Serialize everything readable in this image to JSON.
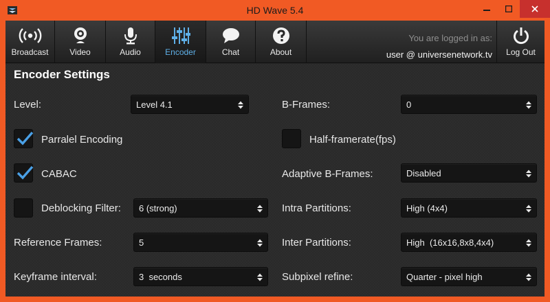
{
  "window": {
    "title": "HD Wave 5.4",
    "accent_color": "#f15a24",
    "close_color": "#c7302d"
  },
  "toolbar": {
    "tabs": [
      {
        "label": "Broadcast",
        "icon": "broadcast-icon"
      },
      {
        "label": "Video",
        "icon": "webcam-icon"
      },
      {
        "label": "Audio",
        "icon": "microphone-icon"
      },
      {
        "label": "Encoder",
        "icon": "sliders-icon",
        "active": true
      },
      {
        "label": "Chat",
        "icon": "chat-bubble-icon"
      },
      {
        "label": "About",
        "icon": "question-icon"
      }
    ],
    "active_color": "#5fb0e8",
    "login_line1": "You are logged in as:",
    "login_user": "user @ universenetwork.tv",
    "logout_label": "Log Out"
  },
  "encoder": {
    "heading": "Encoder Settings",
    "level": {
      "label": "Level:",
      "value": "Level 4.1"
    },
    "parallel": {
      "label": "Parralel Encoding",
      "checked": true
    },
    "cabac": {
      "label": "CABAC",
      "checked": true
    },
    "deblocking": {
      "label": "Deblocking Filter:",
      "checked": false,
      "value": "6 (strong)"
    },
    "ref_frames": {
      "label": "Reference Frames:",
      "value": "5"
    },
    "keyframe": {
      "label": "Keyframe interval:",
      "value": "3  seconds"
    },
    "bframes": {
      "label": "B-Frames:",
      "value": "0"
    },
    "half_framerate": {
      "label": "Half-framerate(fps)",
      "checked": false
    },
    "adaptive_bframes": {
      "label": "Adaptive B-Frames:",
      "value": "Disabled"
    },
    "intra": {
      "label": "Intra Partitions:",
      "value": "High (4x4)"
    },
    "inter": {
      "label": "Inter Partitions:",
      "value": "High  (16x16,8x8,4x4)"
    },
    "subpixel": {
      "label": "Subpixel refine:",
      "value": "Quarter - pixel high"
    }
  }
}
